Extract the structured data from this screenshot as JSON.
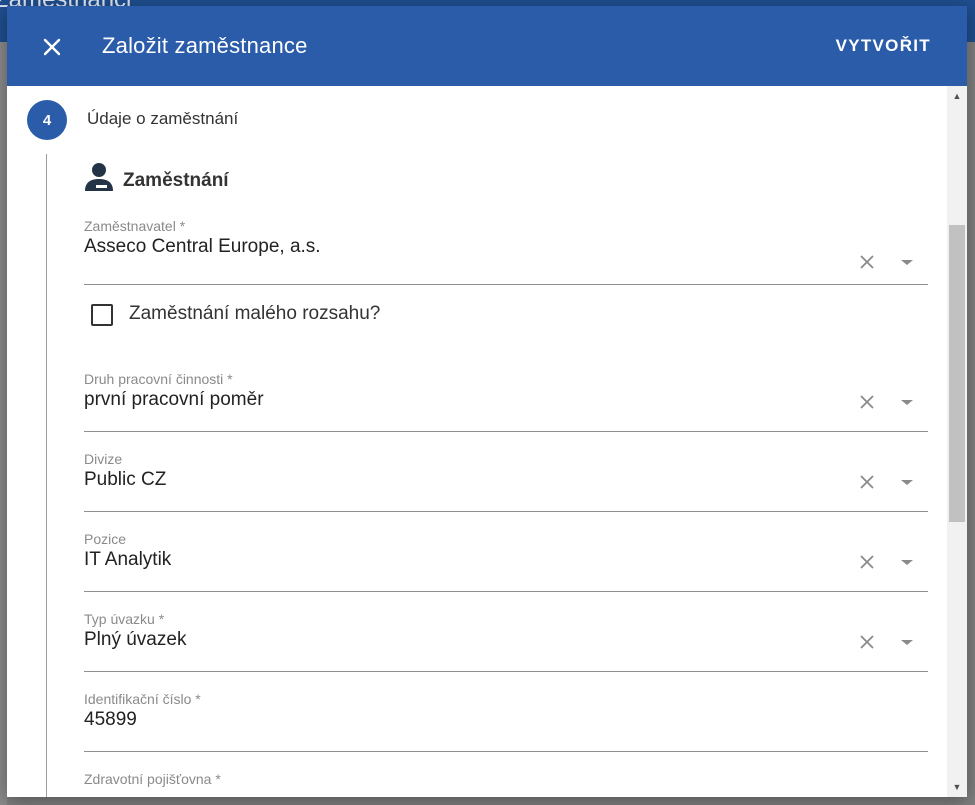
{
  "background": {
    "page_title": "Zaměstnanci"
  },
  "dialog": {
    "title": "Založit zaměstnance",
    "create_label": "VYTVOŘIT",
    "close_icon": "close-icon"
  },
  "step": {
    "number": "4",
    "label": "Údaje o zaměstnání"
  },
  "section": {
    "title": "Zaměstnání",
    "icon": "person-badge-icon"
  },
  "fields": {
    "employer": {
      "label": "Zaměstnavatel *",
      "value": "Asseco Central Europe, a.s."
    },
    "small_employment": {
      "label": "Zaměstnání malého rozsahu?",
      "checked": false
    },
    "work_type": {
      "label": "Druh pracovní činnosti *",
      "value": "první pracovní poměr"
    },
    "division": {
      "label": "Divize",
      "value": "Public CZ"
    },
    "position": {
      "label": "Pozice",
      "value": "IT Analytik"
    },
    "contract_type": {
      "label": "Typ úvazku *",
      "value": "Plný úvazek"
    },
    "id_number": {
      "label": "Identifikační číslo *",
      "value": "45899"
    },
    "health_insurance": {
      "label": "Zdravotní pojišťovna *",
      "value": ""
    }
  },
  "colors": {
    "primary": "#2a5caa",
    "header_text": "#ffffff"
  }
}
